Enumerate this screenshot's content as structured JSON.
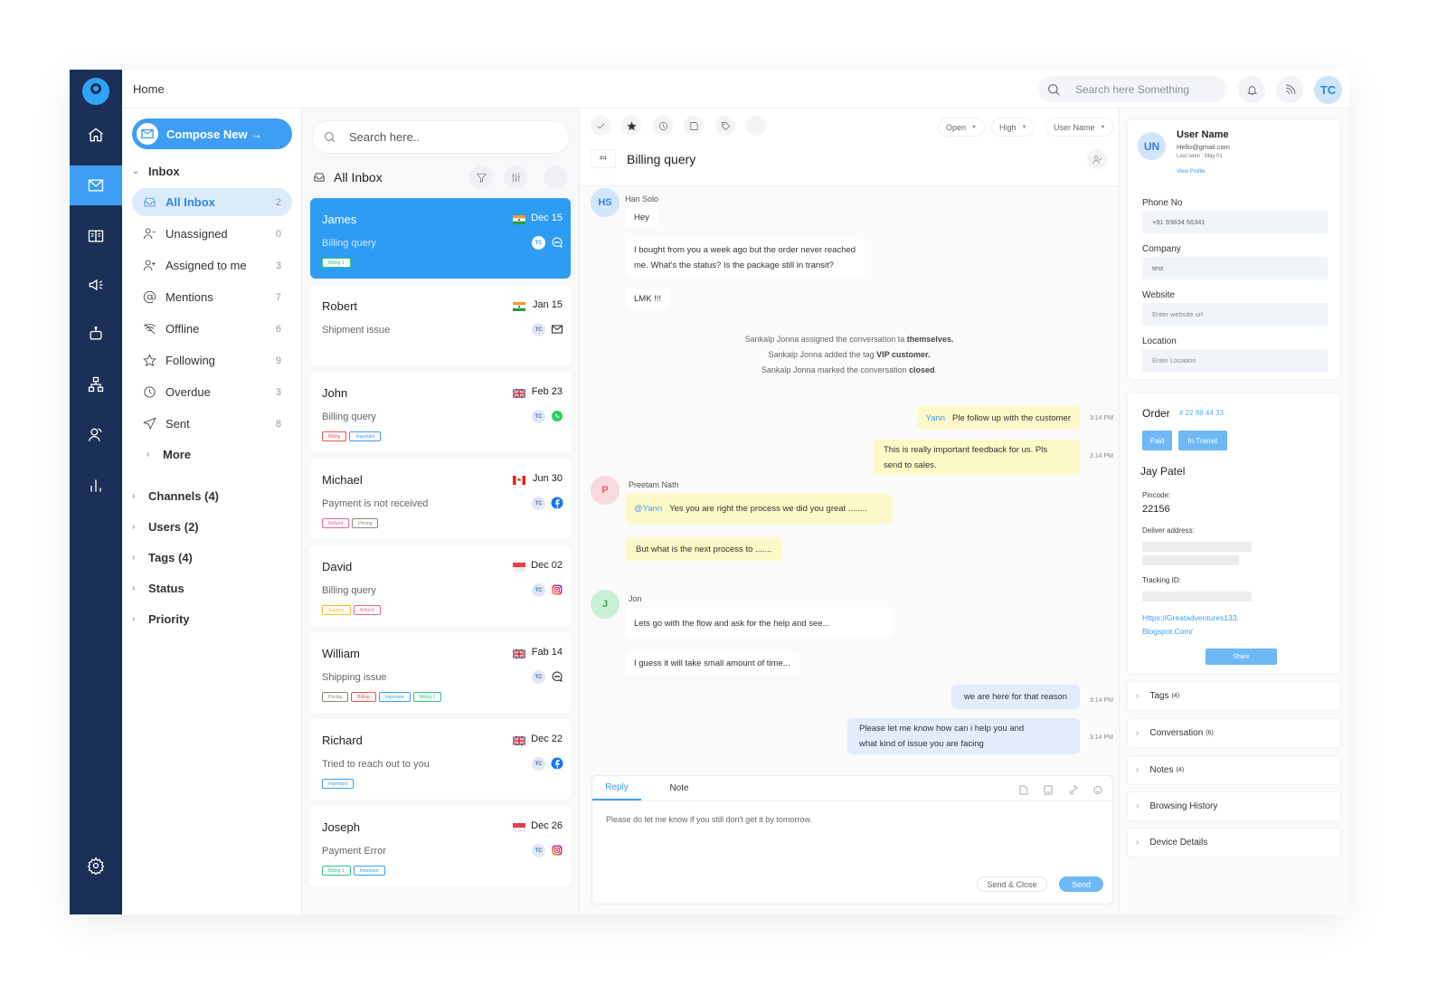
{
  "topbar": {
    "breadcrumb": "Home",
    "search_placeholder": "Search here Something",
    "user_initials": "TC"
  },
  "rail": {
    "items": [
      "home-icon",
      "mail-icon",
      "book-icon",
      "megaphone-icon",
      "bot-icon",
      "hierarchy-icon",
      "contacts-icon",
      "chart-icon",
      "gear-icon"
    ],
    "active": "mail-icon"
  },
  "nav": {
    "compose_label": "Compose New →",
    "inbox_label": "Inbox",
    "items": [
      {
        "label": "All Inbox",
        "count": "2",
        "icon": "inbox-icon",
        "active": true
      },
      {
        "label": "Unassigned",
        "count": "0",
        "icon": "user-minus-icon"
      },
      {
        "label": "Assigned to me",
        "count": "3",
        "icon": "user-plus-icon"
      },
      {
        "label": "Mentions",
        "count": "7",
        "icon": "at-icon"
      },
      {
        "label": "Offline",
        "count": "6",
        "icon": "wifi-off-icon"
      },
      {
        "label": "Following",
        "count": "9",
        "icon": "star-icon"
      },
      {
        "label": "Overdue",
        "count": "3",
        "icon": "clock-icon"
      },
      {
        "label": "Sent",
        "count": "8",
        "icon": "send-icon"
      }
    ],
    "more_label": "More",
    "groups": [
      "Channels (4)",
      "Users (2)",
      "Tags (4)",
      "Status",
      "Priority"
    ]
  },
  "list": {
    "search_placeholder": "Search here..",
    "heading": "All Inbox",
    "conversations": [
      {
        "name": "James",
        "date": "Dec 15",
        "flag": "india",
        "subject": "Billing query",
        "agent": "TC",
        "channel": "chat",
        "tags": [
          {
            "label": "Billing 1",
            "color": "#2ec27e"
          }
        ],
        "active": true
      },
      {
        "name": "Robert",
        "date": "Jan 15",
        "flag": "india",
        "subject": "Shipment issue",
        "agent": "TC",
        "channel": "email",
        "tags": []
      },
      {
        "name": "John",
        "date": "Feb 23",
        "flag": "uk",
        "subject": "Billing query",
        "agent": "TC",
        "channel": "whatsapp",
        "tags": [
          {
            "label": "Billing",
            "color": "#f0524f"
          },
          {
            "label": "Important",
            "color": "#3d9ef3"
          }
        ]
      },
      {
        "name": "Michael",
        "date": "Jun 30",
        "flag": "canada",
        "subject": "Payment is not received",
        "agent": "TC",
        "channel": "facebook",
        "tags": [
          {
            "label": "Refund",
            "color": "#f06292"
          },
          {
            "label": "Pricing",
            "color": "#8a8a76"
          }
        ]
      },
      {
        "name": "David",
        "date": "Dec 02",
        "flag": "singapore",
        "subject": "Billing query",
        "agent": "TC",
        "channel": "instagram",
        "tags": [
          {
            "label": "Support",
            "color": "#f5b82e"
          },
          {
            "label": "Refund",
            "color": "#f06292"
          }
        ]
      },
      {
        "name": "William",
        "date": "Fab 14",
        "flag": "uk",
        "subject": "Shipping issue",
        "agent": "TC",
        "channel": "chat",
        "tags": [
          {
            "label": "Pricing",
            "color": "#8a8a76"
          },
          {
            "label": "Billing",
            "color": "#f0524f"
          },
          {
            "label": "Important",
            "color": "#3d9ef3"
          },
          {
            "label": "Billing 1",
            "color": "#2ec27e"
          }
        ]
      },
      {
        "name": "Richard",
        "date": "Dec 22",
        "flag": "uk",
        "subject": "Tried to reach out to you",
        "agent": "TC",
        "channel": "facebook",
        "tags": [
          {
            "label": "Important",
            "color": "#3d9ef3"
          }
        ]
      },
      {
        "name": "Joseph",
        "date": "Dec 26",
        "flag": "singapore",
        "subject": "Payment Error",
        "agent": "TC",
        "channel": "instagram",
        "tags": [
          {
            "label": "Billing 1",
            "color": "#2ec27e"
          },
          {
            "label": "Important",
            "color": "#3d9ef3"
          }
        ]
      }
    ]
  },
  "conversation": {
    "toolbar": [
      "check-icon",
      "star-icon",
      "clock-icon",
      "note-icon",
      "tag-icon",
      "more-icon"
    ],
    "status": "Open",
    "priority": "High",
    "assignee": "User Name",
    "ticket": "#4",
    "title": "Billing query",
    "messages": {
      "han": {
        "initials": "HS",
        "name": "Han Solo",
        "texts": [
          "Hey",
          "I bought from you a week ago but the order never reached",
          "me. What's the status? Is the package still in transit?",
          "LMK !!!"
        ]
      },
      "system": [
        {
          "pre": "Sankalp Jonna assigned the conversation ta ",
          "bold": "themselves.",
          "post": ""
        },
        {
          "pre": "Sankalp Jonna added the tag ",
          "bold": "VIP customer.",
          "post": ""
        },
        {
          "pre": "Sankalp Jonna marked the conversation ",
          "bold": "closed",
          "post": "."
        }
      ],
      "note1": {
        "mention": "Yann",
        "text": "Ple follow up with the customer",
        "time": "3:14 PM"
      },
      "note2": {
        "line1": "This is really important feedback for us. Pls",
        "line2": "send to sales.",
        "time": "3:14 PM"
      },
      "preetam": {
        "initials": "P",
        "name": "Preetam Nath",
        "mention": "@Yann",
        "text1": "Yes you are right the process we did you great ........",
        "text2": "But what is the next process to ......."
      },
      "jon": {
        "initials": "J",
        "name": "Jon",
        "text1": "Lets go with the flow and ask for the help and see...",
        "text2": "I guess it will take small amount of time..."
      },
      "agent1": {
        "text": "we are here for that reason",
        "time": "3:14 PM"
      },
      "agent2": {
        "line1": "Please let me know how can i help you and",
        "line2": "what kind of issue you are facing",
        "time": "3:14 PM"
      }
    },
    "composer": {
      "tab_reply": "Reply",
      "tab_note": "Note",
      "text": "Please do let me know if you still don't get it by tomorrow.",
      "send_close": "Send & Close",
      "send": "Send"
    }
  },
  "profile": {
    "initials": "UN",
    "name": "User Name",
    "email": "Hello@gmail.com",
    "last_seen": "Last seen : May 01",
    "view_profile": "View Profile",
    "fields": [
      {
        "label": "Phone No",
        "value": "+91 93834 56341"
      },
      {
        "label": "Company",
        "value": "test"
      },
      {
        "label": "Website",
        "placeholder": "Enter website url"
      },
      {
        "label": "Location",
        "placeholder": "Enter Location"
      }
    ]
  },
  "order": {
    "title": "Order",
    "number": "# 22 88 44 33",
    "status_paid": "Paid",
    "status_transit": "In Transit",
    "customer": "Jay Patel",
    "pincode_label": "Pincode:",
    "pincode": "22156",
    "address_label": "Deliver address:",
    "tracking_label": "Tracking ID:",
    "link_line1": "Https://Greatadventures133.",
    "link_line2": "Blogspot.Com/",
    "share": "Share"
  },
  "accordions": [
    {
      "label": "Tags",
      "count": "(4)"
    },
    {
      "label": "Conversation",
      "count": "(6)"
    },
    {
      "label": "Notes",
      "count": "(4)"
    },
    {
      "label": "Browsing History",
      "count": ""
    },
    {
      "label": "Device Details",
      "count": ""
    }
  ]
}
